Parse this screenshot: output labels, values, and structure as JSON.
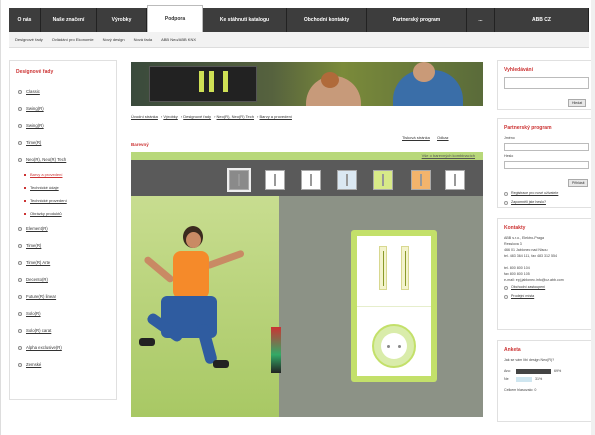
{
  "topnav": {
    "items": [
      "O nás",
      "Naše značení",
      "Výrobky",
      "Podpora",
      "Ke stáhnutí katalogu",
      "Obchodní kontakty",
      "Partnerský program",
      "...",
      "ABB CZ"
    ],
    "active_index": 3
  },
  "subnav": {
    "items": [
      "Designové řady",
      "Ovládání pro Ekonomie",
      "Nový design",
      "Nová řada",
      "ABB Neo/ABB KNX"
    ]
  },
  "sidebar": {
    "title": "Designové řady",
    "items": [
      {
        "label": "Classic",
        "type": "item"
      },
      {
        "label": "Swing(R)",
        "type": "item"
      },
      {
        "label": "Swing(R)",
        "type": "item"
      },
      {
        "label": "Time(R)",
        "type": "item"
      },
      {
        "label": "Neo(R), Neo(R) Tech",
        "type": "item"
      },
      {
        "label": "Barvy a provedení",
        "type": "sub",
        "red": true
      },
      {
        "label": "Technické údaje",
        "type": "sub",
        "red": false
      },
      {
        "label": "Technické provedení",
        "type": "sub",
        "red": false
      },
      {
        "label": "Obrázky produktů",
        "type": "sub",
        "red": false
      },
      {
        "label": "Element(R)",
        "type": "item"
      },
      {
        "label": "Time(R)",
        "type": "item"
      },
      {
        "label": "Time(R) Arte",
        "type": "item"
      },
      {
        "label": "Decento(R)",
        "type": "item"
      },
      {
        "label": "Future(R) linear",
        "type": "item"
      },
      {
        "label": "Solo(R)",
        "type": "item"
      },
      {
        "label": "Solo(R) carat",
        "type": "item"
      },
      {
        "label": "Alpha exclusive(R)",
        "type": "item"
      },
      {
        "label": "Zemské",
        "type": "item"
      }
    ]
  },
  "breadcrumb": [
    "Úvodní stránka",
    "Výrobky",
    "Designové řady",
    "Neo(R), Neo(R) Tech",
    "Barvy a provedení"
  ],
  "tools": [
    "Tisková stránka",
    "Odkaz"
  ],
  "section_title": "Barevný",
  "product": {
    "top_link": "Vše o barevných kombinacích",
    "swatches": [
      {
        "color": "#e6e6e6",
        "selected": true
      },
      {
        "color": "#ffffff",
        "selected": false
      },
      {
        "color": "#ffffff",
        "selected": false
      },
      {
        "color": "#dbe8f2",
        "selected": false
      },
      {
        "color": "#d8ea88",
        "selected": false
      },
      {
        "color": "#f3b46c",
        "selected": false
      },
      {
        "color": "#ffffff",
        "selected": false
      }
    ]
  },
  "right": {
    "search": {
      "title": "Vyhledávání",
      "button": "Hledat"
    },
    "partner": {
      "title": "Partnerský program",
      "login_label": "Jméno",
      "pass_label": "Heslo",
      "button": "Přihlásit",
      "links": [
        "Registrace pro nové uživatele",
        "Zapomněli jste heslo?"
      ]
    },
    "contact": {
      "title": "Kontakty",
      "lines": [
        "ABB s.r.o., Elektro-Praga",
        "Resslova 3",
        "466 01 Jablonec nad Nisou",
        "tel. 483 364 111, fax 483 312 554",
        "",
        "tel. 800 800 104",
        "fax 800 800 105",
        "e-mail: epj.jablonec.info@cz.abb.com"
      ],
      "links": [
        "Obchodní zastoupení",
        "Prodejní místa"
      ]
    },
    "stats": {
      "title": "Anketa",
      "question": "Jak se vám líbí design Neo(R)?",
      "rows": [
        {
          "label": "Ano",
          "value": "69%",
          "pct": 0.69
        },
        {
          "label": "Ne",
          "value": "31%",
          "pct": 0.31
        }
      ],
      "footer": "Celkem hlasovalo: 0"
    }
  }
}
